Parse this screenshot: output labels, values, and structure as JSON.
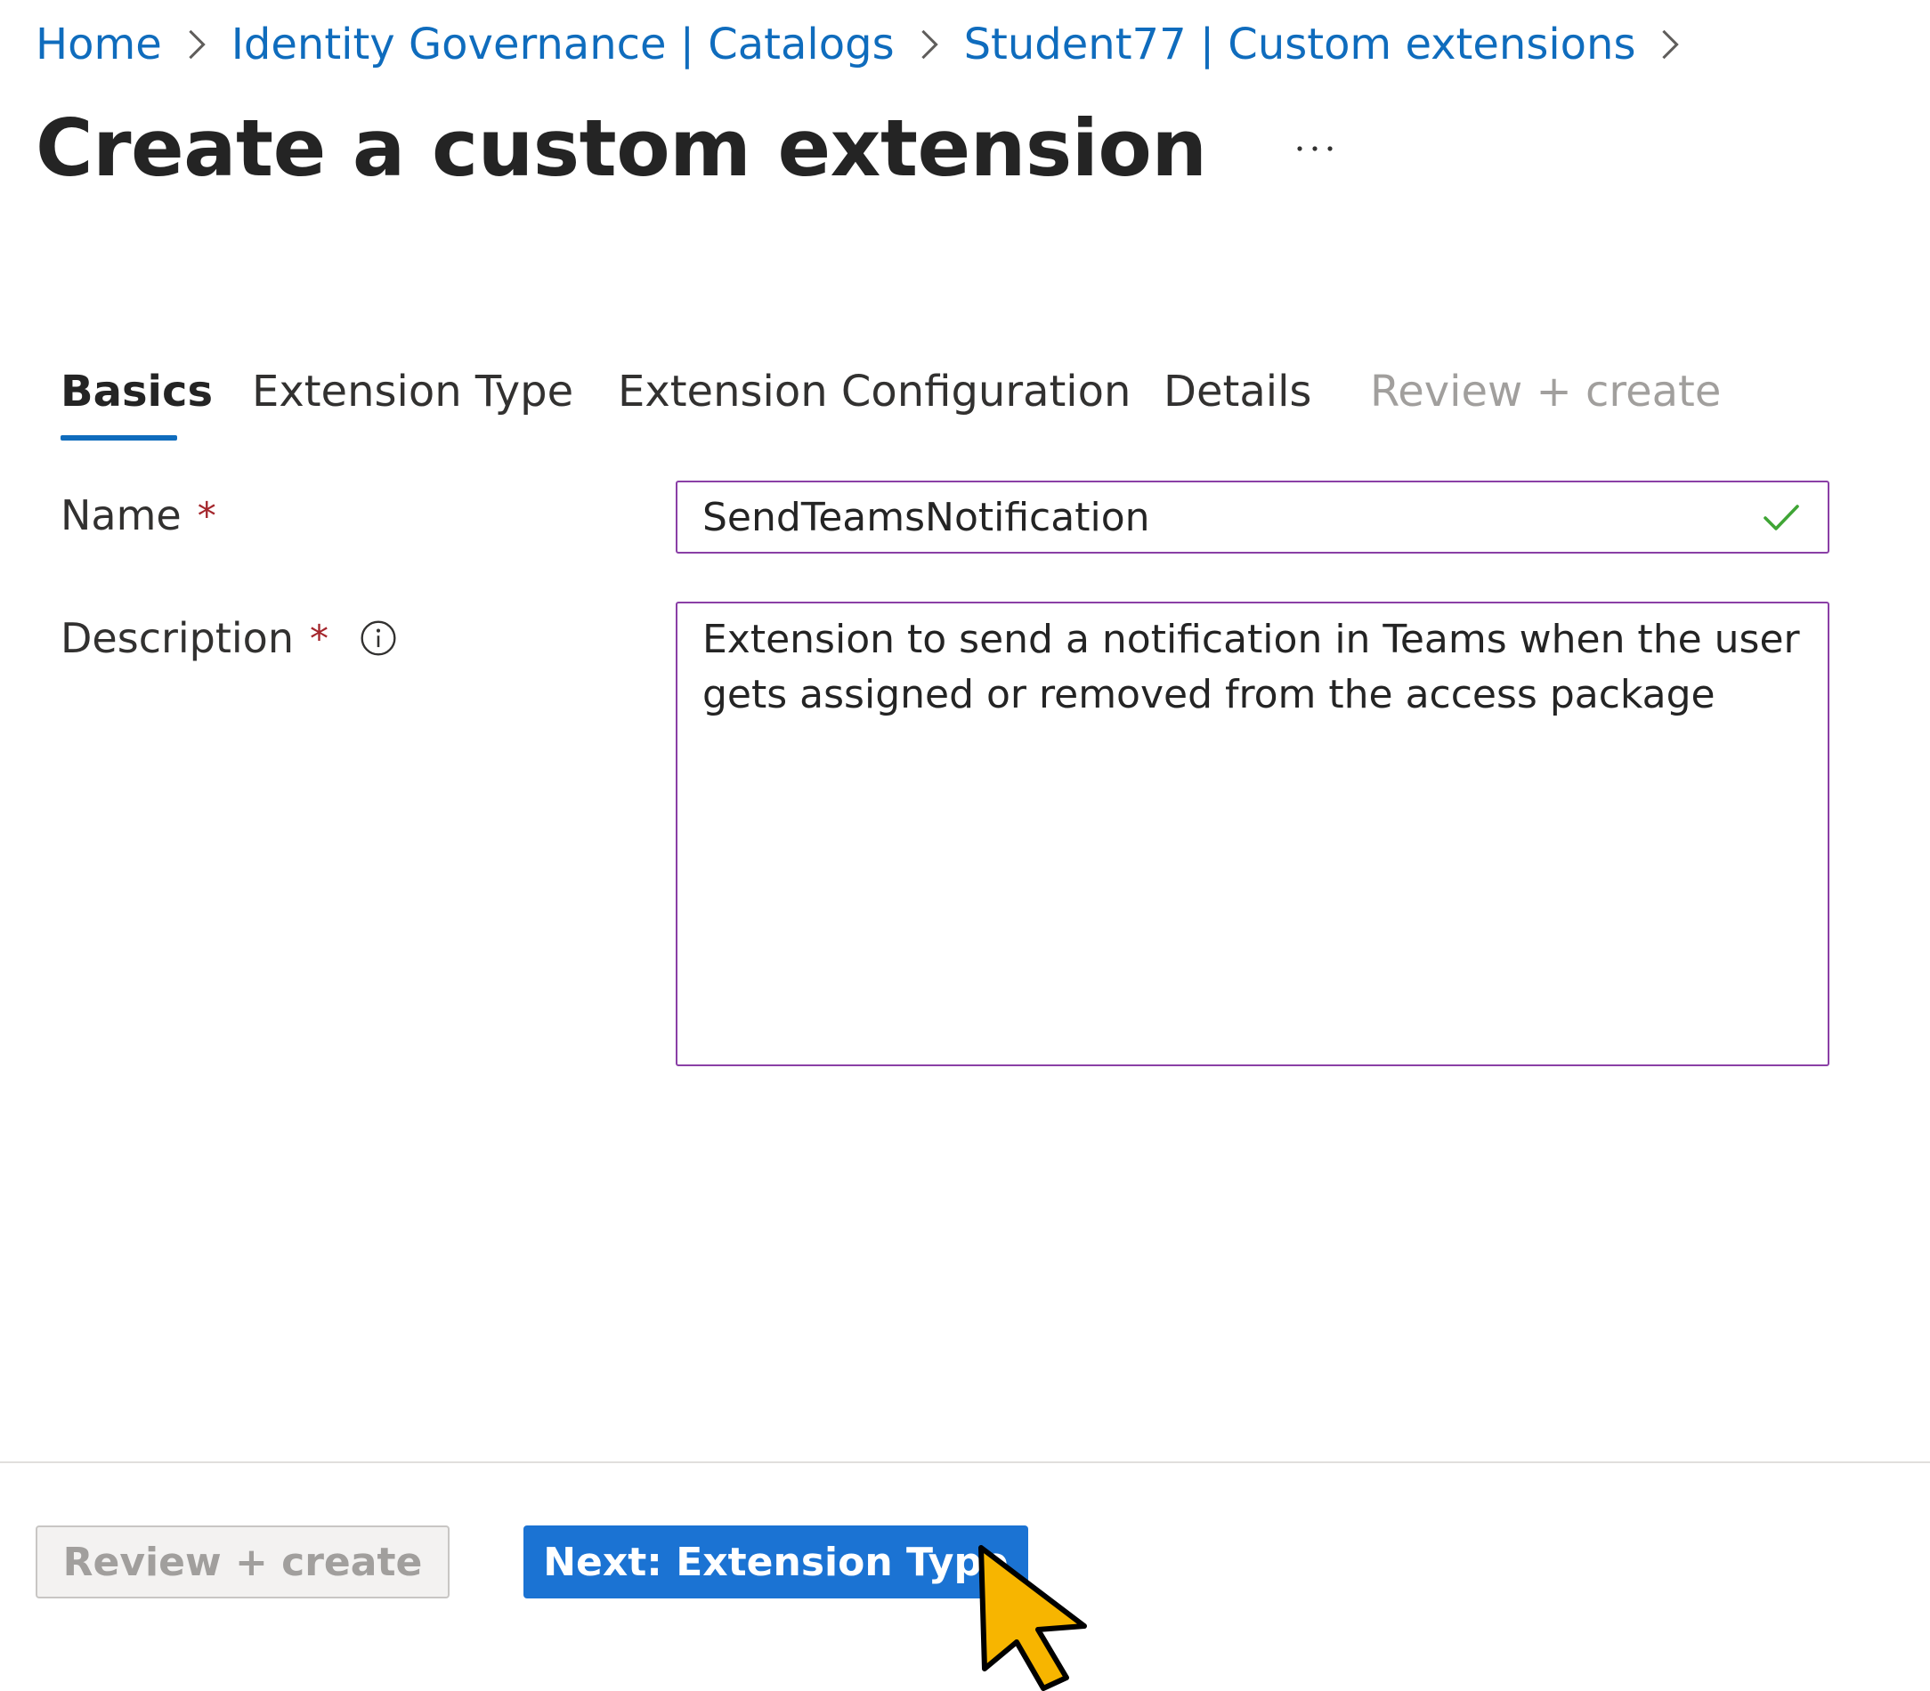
{
  "breadcrumb": {
    "items": [
      {
        "label": "Home"
      },
      {
        "label": "Identity Governance | Catalogs"
      },
      {
        "label": "Student77 | Custom extensions"
      }
    ]
  },
  "page": {
    "title": "Create a custom extension",
    "more_label": "···"
  },
  "tabs": [
    {
      "label": "Basics",
      "state": "active"
    },
    {
      "label": "Extension Type",
      "state": "enabled"
    },
    {
      "label": "Extension Configuration",
      "state": "enabled"
    },
    {
      "label": "Details",
      "state": "enabled"
    },
    {
      "label": "Review + create",
      "state": "disabled"
    }
  ],
  "form": {
    "name": {
      "label": "Name",
      "required_mark": "*",
      "value": "SendTeamsNotification",
      "valid_icon": "checkmark-icon"
    },
    "description": {
      "label": "Description",
      "required_mark": "*",
      "info_icon": "info-icon",
      "value": "Extension to send a notification in Teams when the user gets assigned or removed from the access package"
    }
  },
  "footer": {
    "review_create_label": "Review + create",
    "next_label": "Next: Extension Type"
  },
  "colors": {
    "link": "#0f6cbd",
    "primary_button": "#1b73d3",
    "input_border": "#8a3fa6",
    "required": "#a4262c",
    "valid_check": "#3fa535",
    "cursor_fill": "#f7b500"
  }
}
